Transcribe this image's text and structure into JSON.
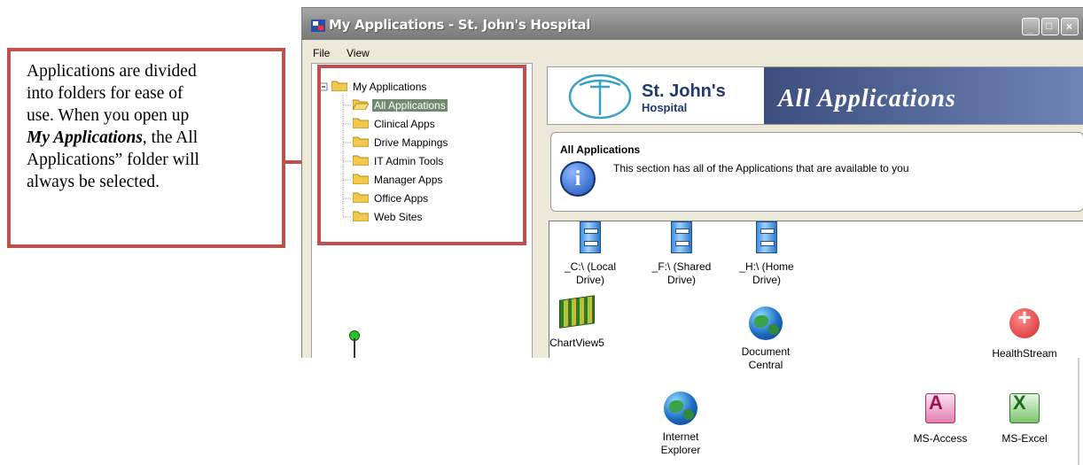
{
  "callout": {
    "line1": "Applications are divided",
    "line2": "into folders for ease of",
    "line3": "use.  When you open up",
    "line4_em": "My Applications",
    "line4_rest": ", the All",
    "line5": "Applications” folder will",
    "line6": "always be selected."
  },
  "window": {
    "title": "My Applications - St. John's Hospital",
    "menu": [
      "File",
      "View"
    ]
  },
  "tree": {
    "root": "My Applications",
    "items": [
      {
        "label": "All Applications",
        "selected": true
      },
      {
        "label": "Clinical Apps",
        "selected": false
      },
      {
        "label": "Drive Mappings",
        "selected": false
      },
      {
        "label": "IT Admin Tools",
        "selected": false
      },
      {
        "label": "Manager Apps",
        "selected": false
      },
      {
        "label": "Office Apps",
        "selected": false
      },
      {
        "label": "Web Sites",
        "selected": false
      }
    ]
  },
  "banner": {
    "logo_line1": "St. John's",
    "logo_line2": "Hospital",
    "heading": "All Applications"
  },
  "info": {
    "heading": "All Applications",
    "icon_letter": "i",
    "description": "This section has all of the Applications that are available to you"
  },
  "apps": [
    {
      "icon": "file-cabinet-icon",
      "line1": "_C:\\ (Local",
      "line2": "Drive)"
    },
    {
      "icon": "file-cabinet-icon",
      "line1": "_F:\\ (Shared",
      "line2": "Drive)"
    },
    {
      "icon": "file-cabinet-icon",
      "line1": "_H:\\ (Home",
      "line2": "Drive)"
    },
    {
      "icon": "chartview-icon",
      "line1": "ChartView5",
      "line2": ""
    },
    {
      "icon": "globe-icon",
      "line1": "Document",
      "line2": "Central"
    },
    {
      "icon": "healthstream-icon",
      "line1": "HealthStream",
      "line2": ""
    },
    {
      "icon": "globe-icon",
      "line1": "Internet",
      "line2": "Explorer"
    },
    {
      "icon": "ms-access-icon",
      "line1": "MS-Access",
      "line2": ""
    },
    {
      "icon": "ms-excel-icon",
      "line1": "MS-Excel",
      "line2": ""
    }
  ],
  "colors": {
    "callout_border": "#c0504d",
    "selection": "#6f8a6f",
    "banner_blue": "#3b4e7e"
  }
}
